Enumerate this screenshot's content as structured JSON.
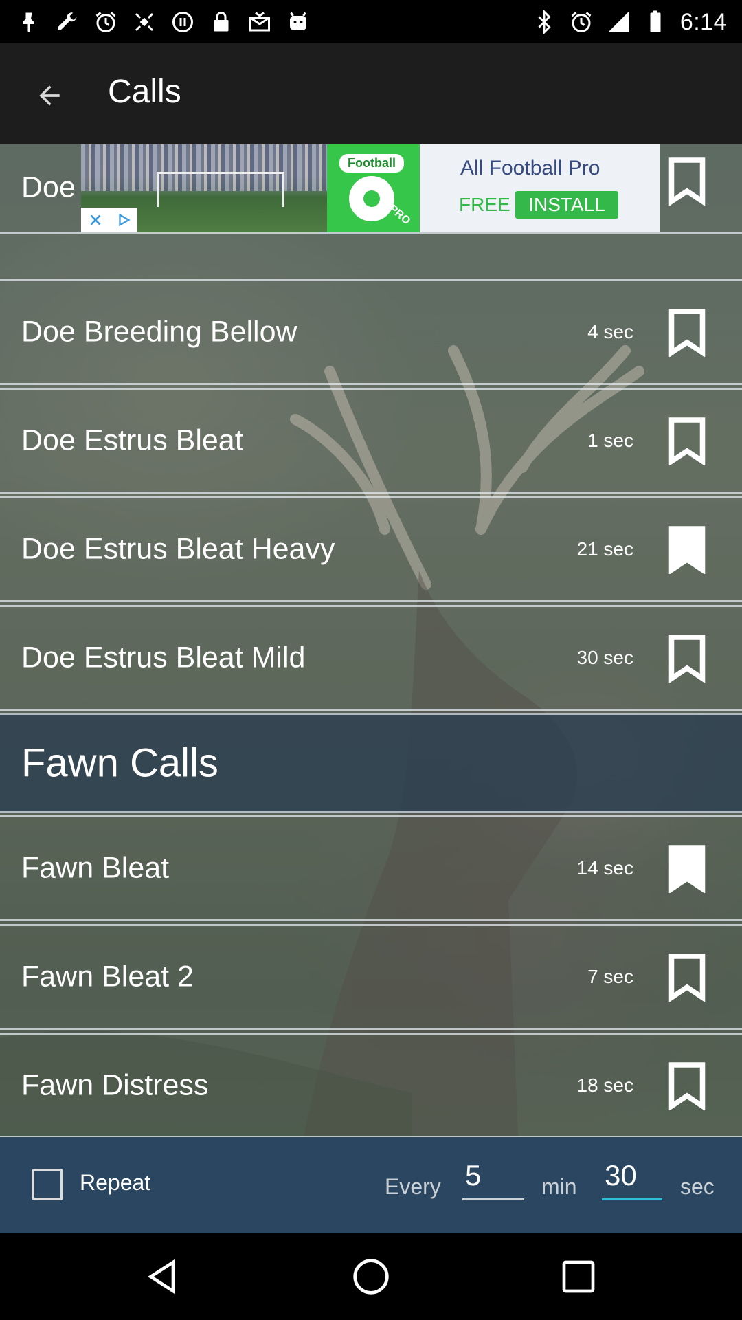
{
  "status_bar": {
    "time": "6:14",
    "left_icons": [
      "pin-icon",
      "wrench-icon",
      "alarm-icon",
      "fake-gps-icon",
      "media-icon",
      "lock-icon",
      "mail-icon",
      "android-icon"
    ],
    "right_icons": [
      "bluetooth-icon",
      "alarm-icon",
      "signal-icon",
      "battery-icon"
    ]
  },
  "app_bar": {
    "title": "Calls",
    "back_icon": "arrow-back-icon"
  },
  "ad": {
    "logo_label": "Football",
    "logo_sub": "PRO",
    "title": "All Football Pro",
    "free_label": "FREE",
    "install_label": "INSTALL"
  },
  "list": {
    "partial_row": {
      "name": "Doe Grunt",
      "duration": ""
    },
    "rows": [
      {
        "name": "Doe Breeding Bellow",
        "duration": "4 sec",
        "bookmarked": false
      },
      {
        "name": "Doe Estrus Bleat",
        "duration": "1 sec",
        "bookmarked": false
      },
      {
        "name": "Doe Estrus Bleat Heavy",
        "duration": "21 sec",
        "bookmarked": true
      },
      {
        "name": "Doe Estrus Bleat Mild",
        "duration": "30 sec",
        "bookmarked": false
      }
    ],
    "section_title": "Fawn Calls",
    "section_rows": [
      {
        "name": "Fawn Bleat",
        "duration": "14 sec",
        "bookmarked": true
      },
      {
        "name": "Fawn Bleat 2",
        "duration": "7 sec",
        "bookmarked": false
      },
      {
        "name": "Fawn Distress",
        "duration": "18 sec",
        "bookmarked": false
      }
    ]
  },
  "controls": {
    "repeat_label": "Repeat",
    "repeat_checked": false,
    "every_label": "Every",
    "minutes_value": "5",
    "min_label": "min",
    "seconds_value": "30",
    "sec_label": "sec"
  },
  "nav_bar": {
    "icons": [
      "back-triangle-icon",
      "home-circle-icon",
      "recents-square-icon"
    ]
  },
  "colors": {
    "app_bar": "#1d1d1d",
    "controls_bg": "#2a4660",
    "accent": "#2bc0d8",
    "install_green": "#35b84a"
  }
}
